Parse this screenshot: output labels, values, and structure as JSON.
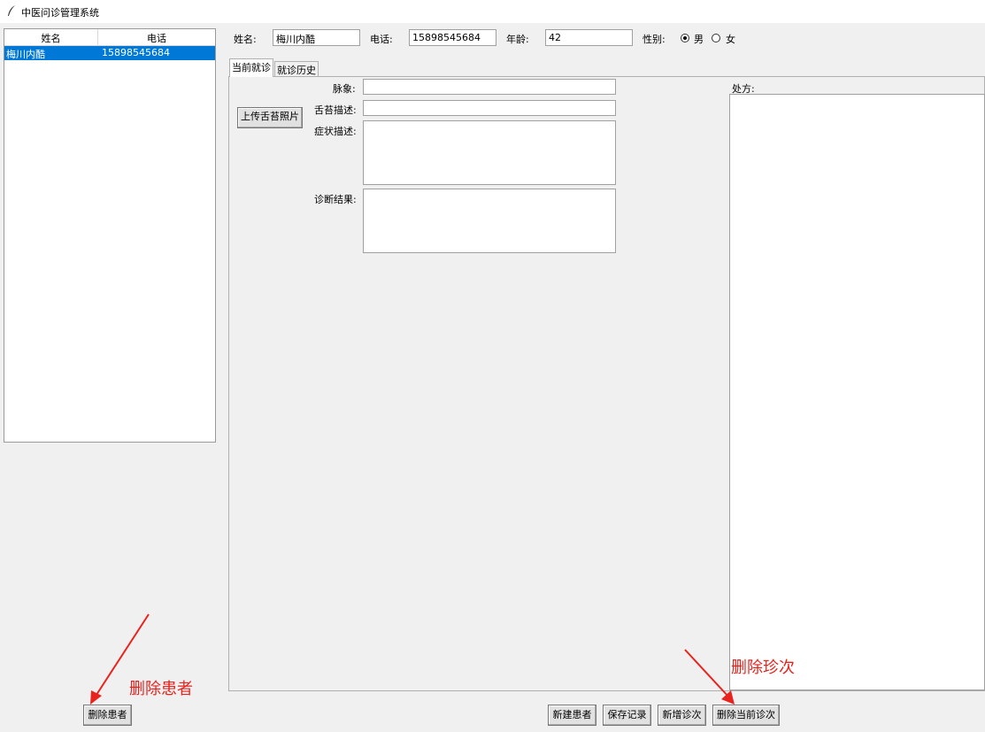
{
  "window": {
    "title": "中医问诊管理系统"
  },
  "patient_list": {
    "columns": [
      "姓名",
      "电话"
    ],
    "rows": [
      {
        "name": "梅川内酷",
        "phone": "15898545684"
      }
    ]
  },
  "form": {
    "name_label": "姓名:",
    "name_value": "梅川内酷",
    "phone_label": "电话:",
    "phone_value": "15898545684",
    "age_label": "年龄:",
    "age_value": "42",
    "gender_label": "性别:",
    "gender_options": [
      "男",
      "女"
    ],
    "gender_selected": "男"
  },
  "tabs": [
    "当前就诊",
    "就诊历史"
  ],
  "visit": {
    "pulse_label": "脉象:",
    "tongue_label": "舌苔描述:",
    "upload_button": "上传舌苔照片",
    "symptom_label": "症状描述:",
    "diagnosis_label": "诊断结果:",
    "prescription_label": "处方:"
  },
  "buttons": {
    "delete_patient": "删除患者",
    "new_patient": "新建患者",
    "save_record": "保存记录",
    "add_visit": "新增诊次",
    "delete_visit": "删除当前诊次"
  },
  "annotations": {
    "delete_patient_note": "删除患者",
    "delete_visit_note": "删除珍次"
  }
}
